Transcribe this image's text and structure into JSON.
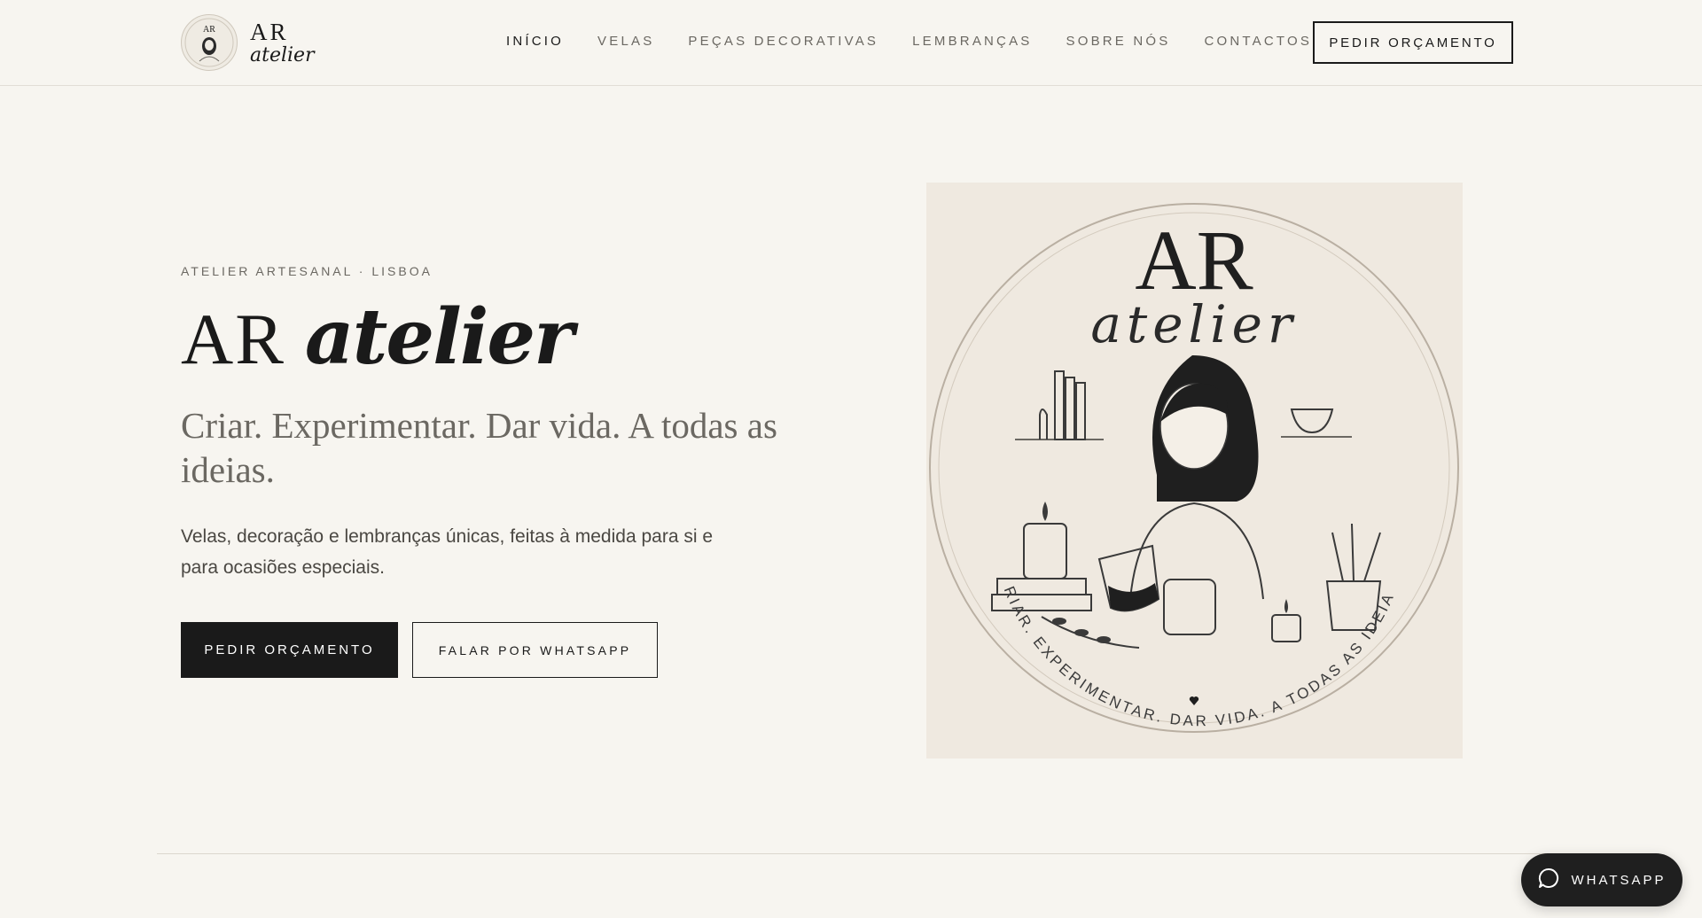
{
  "brand": {
    "logo_ar": "AR",
    "logo_atelier": "atelier"
  },
  "nav": {
    "items": [
      {
        "label": "INÍCIO",
        "active": true
      },
      {
        "label": "VELAS",
        "active": false
      },
      {
        "label": "PEÇAS DECORATIVAS",
        "active": false
      },
      {
        "label": "LEMBRANÇAS",
        "active": false
      },
      {
        "label": "SOBRE NÓS",
        "active": false
      },
      {
        "label": "CONTACTOS",
        "active": false
      }
    ],
    "cta_label": "PEDIR ORÇAMENTO"
  },
  "hero": {
    "eyebrow": "ATELIER ARTESANAL · LISBOA",
    "title_ar": "AR",
    "title_atelier": "atelier",
    "tagline": "Criar. Experimentar. Dar vida. A todas as ideias.",
    "description": "Velas, decoração e lembranças únicas, feitas à medida para si e para ocasiões especiais.",
    "primary_button": "PEDIR ORÇAMENTO",
    "secondary_button": "FALAR POR WHATSAPP",
    "image": {
      "title_ar": "AR",
      "title_atelier": "atelier",
      "circle_text": "CRIAR. EXPERIMENTAR. DAR VIDA. A TODAS AS IDEIAS."
    }
  },
  "floating": {
    "whatsapp_label": "WHATSAPP"
  },
  "colors": {
    "background": "#f7f5f0",
    "text": "#1a1a1a",
    "muted": "#6b6862",
    "image_bg": "#efe9e0"
  }
}
